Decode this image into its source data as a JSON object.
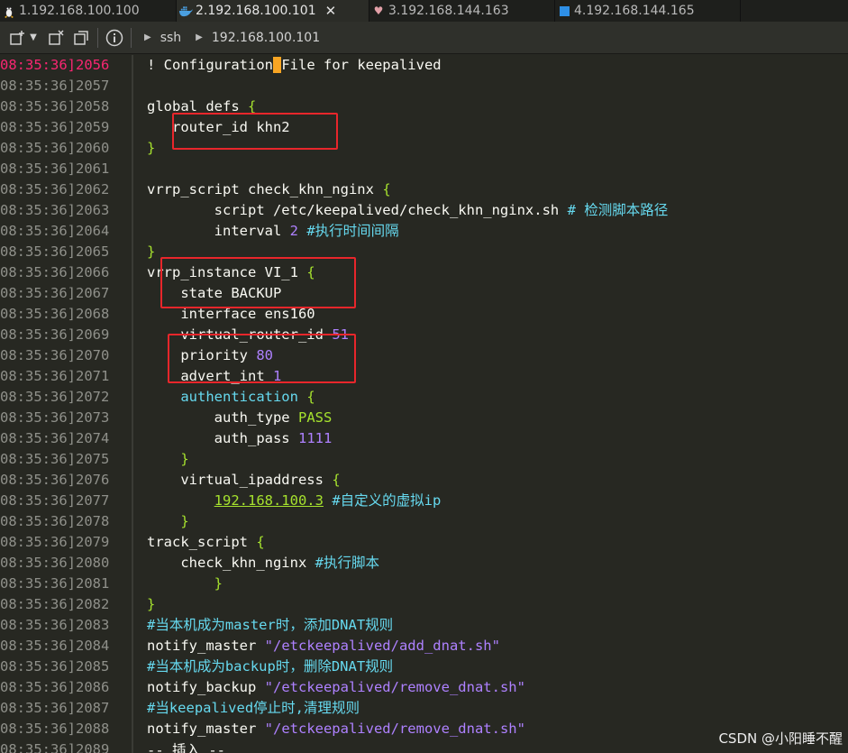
{
  "tabs": [
    {
      "label": "1.192.168.100.100",
      "icon": "linux-penguin-icon",
      "active": false
    },
    {
      "label": "2.192.168.100.101",
      "icon": "docker-whale-icon",
      "active": true
    },
    {
      "label": "3.192.168.144.163",
      "icon": "heart-icon",
      "active": false
    },
    {
      "label": "4.192.168.144.165",
      "icon": "square-icon",
      "active": false
    }
  ],
  "tab_close": "✕",
  "toolbar": {
    "crumbs": [
      "ssh",
      "192.168.100.101"
    ]
  },
  "gutter": {
    "time": "08:35:36]",
    "lines": [
      "2056",
      "2057",
      "2058",
      "2059",
      "2060",
      "2061",
      "2062",
      "2063",
      "2064",
      "2065",
      "2066",
      "2067",
      "2068",
      "2069",
      "2070",
      "2071",
      "2072",
      "2073",
      "2074",
      "2075",
      "2076",
      "2077",
      "2078",
      "2079",
      "2080",
      "2081",
      "2082",
      "2083",
      "2084",
      "2085",
      "2086",
      "2087",
      "2088",
      "2089"
    ]
  },
  "code": {
    "l2056a": "! Configuration",
    "l2056b": " ",
    "l2056c": "File for keepalived",
    "l2058": "global_defs",
    "l2059": "   router_id khn2",
    "l2062": "vrrp_script check_khn_nginx",
    "l2063a": "        script /etc/keepalived/check_khn_nginx.sh ",
    "l2063b": "# 检测脚本路径",
    "l2064a": "        interval ",
    "l2064b": "2",
    "l2064c": " #执行时间间隔",
    "l2066": "vrrp_instance VI_1",
    "l2067": "    state BACKUP",
    "l2068": "    interface ens160",
    "l2069a": "    virtual_router_id ",
    "l2069b": "51",
    "l2070a": "    priority ",
    "l2070b": "80",
    "l2071a": "    advert_int ",
    "l2071b": "1",
    "l2072": "    authentication",
    "l2073a": "        auth_type ",
    "l2073b": "PASS",
    "l2074a": "        auth_pass ",
    "l2074b": "1111",
    "l2076": "    virtual_ipaddress",
    "l2077a": "192.168.100.3",
    "l2077b": " #自定义的虚拟ip",
    "l2079": "track_script",
    "l2080a": "    check_khn_nginx ",
    "l2080b": "#执行脚本",
    "l2083": "#当本机成为master时，添加DNAT规则",
    "l2084a": "notify_master ",
    "l2084b": "\"/etckeepalived/add_dnat.sh\"",
    "l2085": "#当本机成为backup时，删除DNAT规则",
    "l2086a": "notify_backup ",
    "l2086b": "\"/etckeepalived/remove_dnat.sh\"",
    "l2087": "#当keepalived停止时,清理规则",
    "l2088a": "notify_master ",
    "l2088b": "\"/etckeepalived/remove_dnat.sh\"",
    "open_brace": "{",
    "close_brace": "}",
    "mode": "-- 插入 --"
  },
  "watermark": "CSDN @小阳睡不醒",
  "colors": {
    "background": "#272822",
    "annotation": "#e8262b",
    "cursor": "#f8a523",
    "line_number": "#8f908a",
    "current_line": "#f92672"
  }
}
